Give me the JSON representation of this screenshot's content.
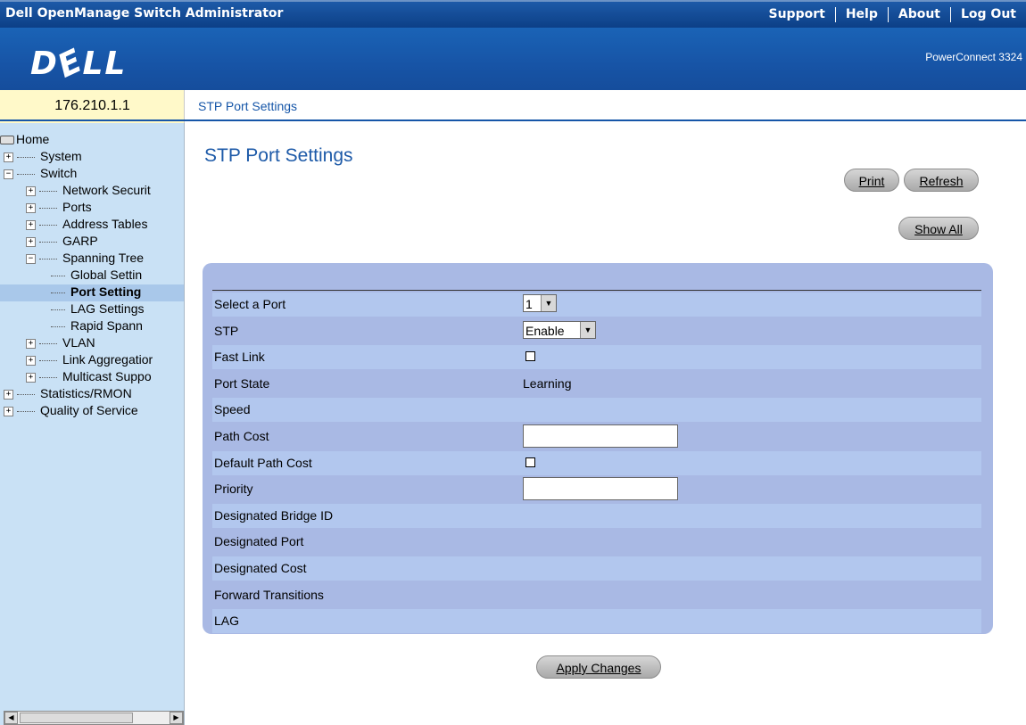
{
  "app_title": "Dell OpenManage Switch Administrator",
  "top_nav": [
    "Support",
    "Help",
    "About",
    "Log Out"
  ],
  "logo_text": "DELL",
  "product_name": "PowerConnect 3324",
  "device_ip": "176.210.1.1",
  "breadcrumb": "STP Port Settings",
  "sidebar": {
    "items": [
      {
        "label": "Home",
        "level": 0,
        "expander": "",
        "icon": "home-icon"
      },
      {
        "label": "System",
        "level": 1,
        "expander": "+"
      },
      {
        "label": "Switch",
        "level": 1,
        "expander": "-"
      },
      {
        "label": "Network Securit",
        "level": 2,
        "expander": "+"
      },
      {
        "label": "Ports",
        "level": 2,
        "expander": "+"
      },
      {
        "label": "Address Tables",
        "level": 2,
        "expander": "+"
      },
      {
        "label": "GARP",
        "level": 2,
        "expander": "+"
      },
      {
        "label": "Spanning Tree",
        "level": 2,
        "expander": "-"
      },
      {
        "label": "Global Settin",
        "level": 3,
        "expander": ""
      },
      {
        "label": "Port Setting",
        "level": 3,
        "expander": "",
        "selected": true
      },
      {
        "label": "LAG Settings",
        "level": 3,
        "expander": ""
      },
      {
        "label": "Rapid Spann",
        "level": 3,
        "expander": ""
      },
      {
        "label": "VLAN",
        "level": 2,
        "expander": "+"
      },
      {
        "label": "Link Aggregatior",
        "level": 2,
        "expander": "+"
      },
      {
        "label": "Multicast Suppo",
        "level": 2,
        "expander": "+"
      },
      {
        "label": "Statistics/RMON",
        "level": 1,
        "expander": "+"
      },
      {
        "label": "Quality of Service",
        "level": 1,
        "expander": "+"
      }
    ]
  },
  "main": {
    "title": "STP Port Settings",
    "print_label": "Print",
    "refresh_label": "Refresh",
    "show_all_label": "Show All",
    "apply_label": "Apply Changes",
    "fields": [
      {
        "label": "Select a Port",
        "control": "select",
        "value": "1"
      },
      {
        "label": "STP",
        "control": "select",
        "value": "Enable"
      },
      {
        "label": "Fast Link",
        "control": "checkbox",
        "checked": false
      },
      {
        "label": "Port State",
        "control": "text",
        "value": "Learning"
      },
      {
        "label": "Speed",
        "control": "text",
        "value": ""
      },
      {
        "label": "Path Cost",
        "control": "input",
        "value": ""
      },
      {
        "label": "Default Path Cost",
        "control": "checkbox",
        "checked": false
      },
      {
        "label": "Priority",
        "control": "input",
        "value": ""
      },
      {
        "label": "Designated Bridge ID",
        "control": "text",
        "value": ""
      },
      {
        "label": "Designated Port",
        "control": "text",
        "value": ""
      },
      {
        "label": "Designated Cost",
        "control": "text",
        "value": ""
      },
      {
        "label": "Forward Transitions",
        "control": "text",
        "value": ""
      },
      {
        "label": "LAG",
        "control": "text",
        "value": ""
      }
    ]
  },
  "colors": {
    "header_blue": "#1656a8",
    "sidebar_bg": "#c9e1f5",
    "ip_bg": "#fff9c9",
    "panel_bg": "#a9b9e4",
    "title_blue": "#1d5aa8"
  }
}
